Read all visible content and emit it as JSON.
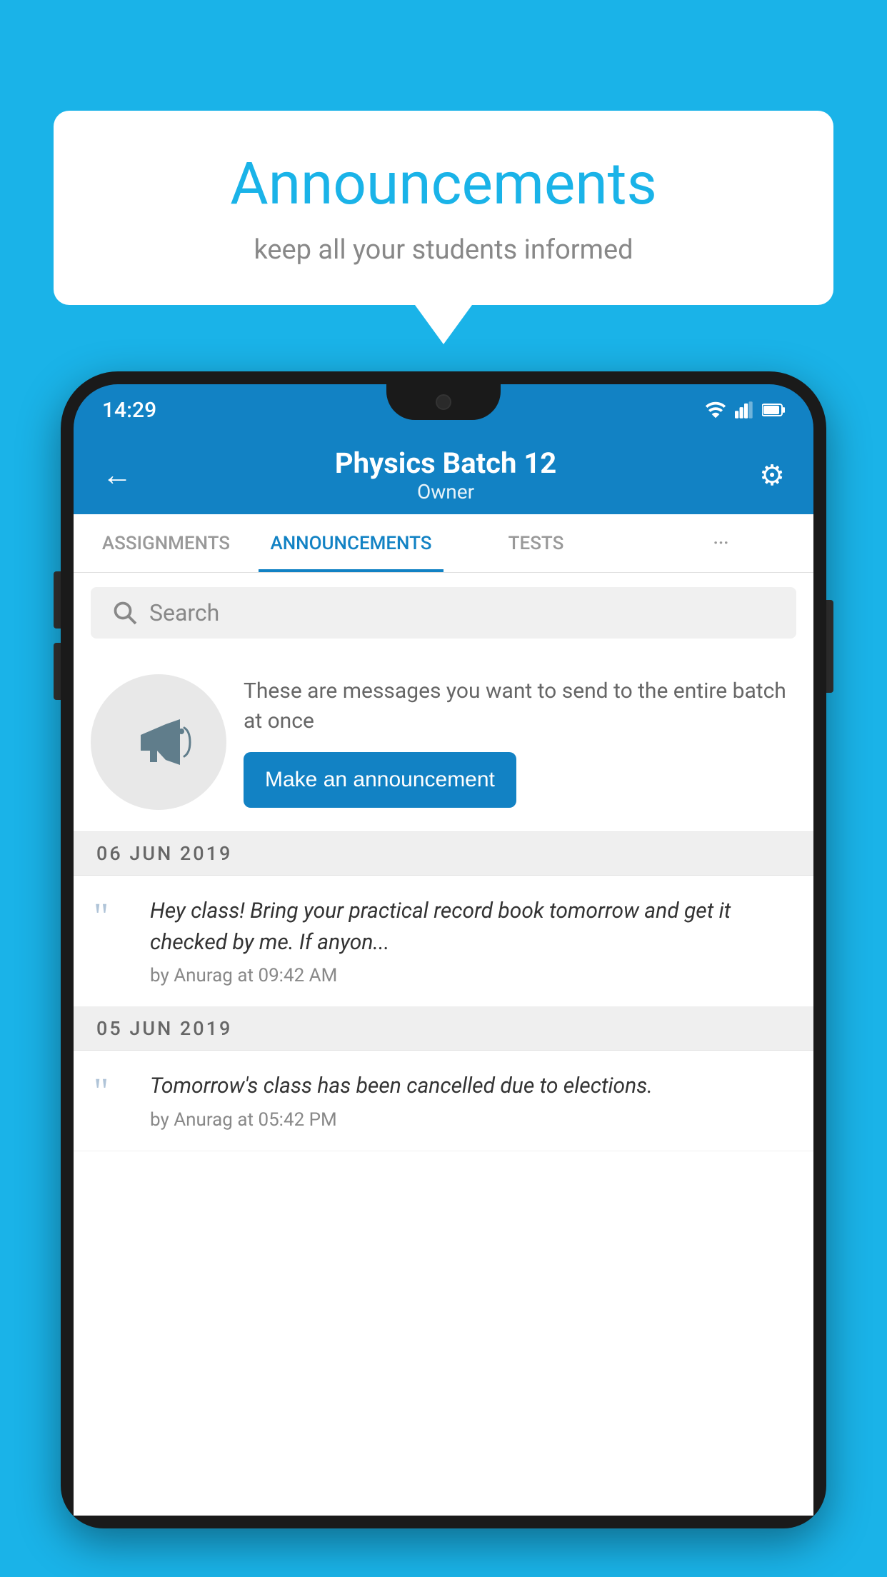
{
  "background_color": "#1ab3e8",
  "speech_bubble": {
    "title": "Announcements",
    "subtitle": "keep all your students informed"
  },
  "phone": {
    "status_bar": {
      "time": "14:29",
      "icons": [
        "wifi",
        "signal",
        "battery"
      ]
    },
    "header": {
      "title": "Physics Batch 12",
      "subtitle": "Owner",
      "back_label": "←",
      "gear_label": "⚙"
    },
    "tabs": [
      {
        "label": "ASSIGNMENTS",
        "active": false
      },
      {
        "label": "ANNOUNCEMENTS",
        "active": true
      },
      {
        "label": "TESTS",
        "active": false
      },
      {
        "label": "···",
        "active": false
      }
    ],
    "search": {
      "placeholder": "Search"
    },
    "promo": {
      "description_text": "These are messages you want to send to the entire batch at once",
      "button_label": "Make an announcement"
    },
    "announcements": [
      {
        "date": "06  JUN  2019",
        "message": "Hey class! Bring your practical record book tomorrow and get it checked by me. If anyon...",
        "meta": "by Anurag at 09:42 AM"
      },
      {
        "date": "05  JUN  2019",
        "message": "Tomorrow's class has been cancelled due to elections.",
        "meta": "by Anurag at 05:42 PM"
      }
    ]
  }
}
